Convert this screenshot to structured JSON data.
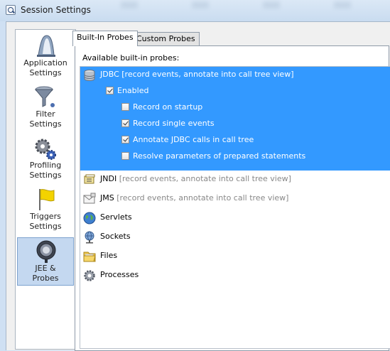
{
  "window": {
    "title": "Session Settings"
  },
  "nav": {
    "items": [
      {
        "label_1": "Application",
        "label_2": "Settings",
        "icon": "application-settings-icon"
      },
      {
        "label_1": "Filter",
        "label_2": "Settings",
        "icon": "filter-funnel-icon"
      },
      {
        "label_1": "Profiling",
        "label_2": "Settings",
        "icon": "profiling-gears-icon"
      },
      {
        "label_1": "Triggers",
        "label_2": "Settings",
        "icon": "triggers-flag-icon"
      },
      {
        "label_1": "JEE &",
        "label_2": "Probes",
        "icon": "jee-probes-icon",
        "selected": true
      }
    ]
  },
  "tabs": [
    {
      "label": "Built-In Probes",
      "active": true
    },
    {
      "label": "Custom Probes",
      "active": false
    }
  ],
  "probes_panel": {
    "heading": "Available built-in probes:",
    "jdbc": {
      "name": "JDBC",
      "description": "[record events, annotate into call tree view]",
      "options": [
        {
          "label": "Enabled",
          "checked": true
        },
        {
          "label": "Record on startup",
          "checked": false
        },
        {
          "label": "Record single events",
          "checked": true
        },
        {
          "label": "Annotate JDBC calls in call tree",
          "checked": true
        },
        {
          "label": "Resolve parameters of prepared statements",
          "checked": false
        }
      ]
    },
    "jndi": {
      "name": "JNDI",
      "description": "[record events, annotate into call tree view]"
    },
    "jms": {
      "name": "JMS",
      "description": "[record events, annotate into call tree view]"
    },
    "servlets": {
      "name": "Servlets"
    },
    "sockets": {
      "name": "Sockets"
    },
    "files": {
      "name": "Files"
    },
    "processes": {
      "name": "Processes"
    }
  },
  "colors": {
    "selection": "#3399ff",
    "nav_selected": "#c4d8f0",
    "chrome": "#cfe0f3"
  }
}
